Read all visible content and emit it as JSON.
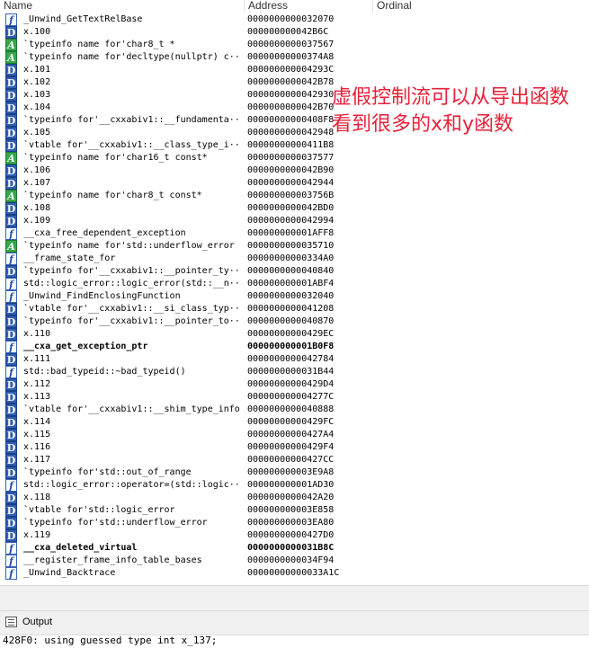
{
  "header": {
    "name": "Name",
    "address": "Address",
    "ordinal": "Ordinal"
  },
  "annotation": {
    "line1": "虚假控制流可以从导出函数",
    "line2": "看到很多的x和y函数"
  },
  "rows": [
    {
      "icon": "f",
      "name": "_Unwind_GetTextRelBase",
      "addr": "0000000000032070"
    },
    {
      "icon": "D",
      "name": "x.100",
      "addr": "000000000042B6C"
    },
    {
      "icon": "A",
      "name": "`typeinfo name for'char8_t *",
      "addr": "0000000000037567"
    },
    {
      "icon": "A",
      "name": "`typeinfo name for'decltype(nullptr) c···",
      "addr": "00000000000374A8"
    },
    {
      "icon": "D",
      "name": "x.101",
      "addr": "000000000004293C"
    },
    {
      "icon": "D",
      "name": "x.102",
      "addr": "0000000000042B78"
    },
    {
      "icon": "D",
      "name": "x.103",
      "addr": "0000000000042930"
    },
    {
      "icon": "D",
      "name": "x.104",
      "addr": "0000000000042B70"
    },
    {
      "icon": "D",
      "name": "`typeinfo for'__cxxabiv1::__fundamenta···",
      "addr": "00000000000408F8"
    },
    {
      "icon": "D",
      "name": "x.105",
      "addr": "0000000000042948"
    },
    {
      "icon": "D",
      "name": "`vtable for'__cxxabiv1::__class_type_i···",
      "addr": "00000000000411B8"
    },
    {
      "icon": "A",
      "name": "`typeinfo name for'char16_t const*",
      "addr": "0000000000037577"
    },
    {
      "icon": "D",
      "name": "x.106",
      "addr": "0000000000042B90"
    },
    {
      "icon": "D",
      "name": "x.107",
      "addr": "0000000000042944"
    },
    {
      "icon": "A",
      "name": "`typeinfo name for'char8_t const*",
      "addr": "000000000003756B"
    },
    {
      "icon": "D",
      "name": "x.108",
      "addr": "0000000000042BD0"
    },
    {
      "icon": "D",
      "name": "x.109",
      "addr": "0000000000042994"
    },
    {
      "icon": "f",
      "name": "__cxa_free_dependent_exception",
      "addr": "000000000001AFF8"
    },
    {
      "icon": "A",
      "name": "`typeinfo name for'std::underflow_error",
      "addr": "0000000000035710"
    },
    {
      "icon": "f",
      "name": "__frame_state_for",
      "addr": "00000000000334A0"
    },
    {
      "icon": "D",
      "name": "`typeinfo for'__cxxabiv1::__pointer_ty···",
      "addr": "0000000000040840"
    },
    {
      "icon": "f",
      "name": "std::logic_error::logic_error(std::__n···",
      "addr": "000000000001ABF4"
    },
    {
      "icon": "f",
      "name": "_Unwind_FindEnclosingFunction",
      "addr": "0000000000032040"
    },
    {
      "icon": "D",
      "name": "`vtable for'__cxxabiv1::__si_class_typ···",
      "addr": "0000000000041208"
    },
    {
      "icon": "D",
      "name": "`typeinfo for'__cxxabiv1::__pointer_to···",
      "addr": "0000000000040870"
    },
    {
      "icon": "D",
      "name": "x.110",
      "addr": "00000000000429EC"
    },
    {
      "icon": "f",
      "name": "__cxa_get_exception_ptr",
      "addr": "000000000001B0F8",
      "bold": true
    },
    {
      "icon": "D",
      "name": "x.111",
      "addr": "0000000000042784"
    },
    {
      "icon": "f",
      "name": "std::bad_typeid::~bad_typeid()",
      "addr": "0000000000031B44"
    },
    {
      "icon": "D",
      "name": "x.112",
      "addr": "00000000000429D4"
    },
    {
      "icon": "D",
      "name": "x.113",
      "addr": "000000000004277C"
    },
    {
      "icon": "D",
      "name": "`vtable for'__cxxabiv1::__shim_type_info",
      "addr": "0000000000040888"
    },
    {
      "icon": "D",
      "name": "x.114",
      "addr": "00000000000429FC"
    },
    {
      "icon": "D",
      "name": "x.115",
      "addr": "00000000000427A4"
    },
    {
      "icon": "D",
      "name": "x.116",
      "addr": "00000000000429F4"
    },
    {
      "icon": "D",
      "name": "x.117",
      "addr": "00000000000427CC"
    },
    {
      "icon": "D",
      "name": "`typeinfo for'std::out_of_range",
      "addr": "000000000003E9A8"
    },
    {
      "icon": "f",
      "name": "std::logic_error::operator=(std::logic···",
      "addr": "000000000001AD30"
    },
    {
      "icon": "D",
      "name": "x.118",
      "addr": "0000000000042A20"
    },
    {
      "icon": "D",
      "name": "`vtable for'std::logic_error",
      "addr": "000000000003E858"
    },
    {
      "icon": "D",
      "name": "`typeinfo for'std::underflow_error",
      "addr": "000000000003EA80"
    },
    {
      "icon": "D",
      "name": "x.119",
      "addr": "00000000000427D0"
    },
    {
      "icon": "f",
      "name": "__cxa_deleted_virtual",
      "addr": "0000000000031B8C",
      "bold": true
    },
    {
      "icon": "f",
      "name": "__register_frame_info_table_bases",
      "addr": "0000000000034F94"
    },
    {
      "icon": "f",
      "name": "_Unwind_Backtrace",
      "addr": "00000000000033A1C"
    }
  ],
  "output": {
    "title": "Output",
    "line": "428F0: using guessed type int x_137;"
  }
}
